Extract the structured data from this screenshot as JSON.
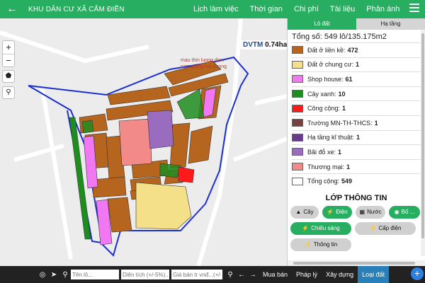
{
  "header": {
    "title": "KHU DÂN CƯ XÃ CẨM ĐIỀN",
    "nav": [
      "Lịch làm việc",
      "Thời gian",
      "Chi phí",
      "Tài liệu",
      "Phản ánh"
    ],
    "back_icon": "arrow-left-icon",
    "menu_icon": "hamburger-icon"
  },
  "map": {
    "zoom_in": "+",
    "zoom_out": "−",
    "dvtm_label": "DVTM",
    "dvtm_value": "0.74ha",
    "label_line1": "mau thin luong dien",
    "label_line2": "cam giang hai duong"
  },
  "panel": {
    "tab_active": "Lô đất",
    "tab_inactive": "Hạ tầng",
    "total": "Tổng số: 549 lô/135.175m2",
    "legend": [
      {
        "label": "Đất ở liền kề:",
        "count": "472",
        "color": "#b5651d"
      },
      {
        "label": "Đất ở chung cư:",
        "count": "1",
        "color": "#f5e08a"
      },
      {
        "label": "Shop house:",
        "count": "61",
        "color": "#f277f2"
      },
      {
        "label": "Cây xanh:",
        "count": "10",
        "color": "#1e8c1e"
      },
      {
        "label": "Công cộng:",
        "count": "1",
        "color": "#ff1a1a"
      },
      {
        "label": "Trường MN-TH-THCS:",
        "count": "1",
        "color": "#7a3f3f"
      },
      {
        "label": "Hạ tầng kĩ thuật:",
        "count": "1",
        "color": "#6a3a8f"
      },
      {
        "label": "Bãi đỗ xe:",
        "count": "1",
        "color": "#9a6cc0"
      },
      {
        "label": "Thương mại:",
        "count": "1",
        "color": "#f28a8a"
      },
      {
        "label": "Tổng cộng:",
        "count": "549",
        "color": "#ffffff"
      }
    ],
    "layer_title": "LỚP THÔNG TIN",
    "buttons": [
      {
        "label": "Cây",
        "state": "off",
        "icon": "tree-icon"
      },
      {
        "label": "Điện",
        "state": "on",
        "icon": "bolt-icon"
      },
      {
        "label": "Nước",
        "state": "off",
        "icon": "water-icon"
      },
      {
        "label": "Bố ...",
        "state": "on",
        "icon": "eye-icon"
      },
      {
        "label": "Chiếu sáng",
        "state": "on",
        "icon": "bolt-icon"
      },
      {
        "label": "Cấp điện",
        "state": "off",
        "icon": "bolt-icon"
      },
      {
        "label": "Thông tin",
        "state": "off",
        "icon": "bolt-icon"
      }
    ]
  },
  "bottom": {
    "input1_placeholder": "Tên lô...",
    "input2_placeholder": "Diện tích (+/-5%)...",
    "input3_placeholder": "Giá bán tr vnđ...(+/-5%)",
    "links": [
      "Mua bán",
      "Pháp lý",
      "Xây dựng",
      "Loại đất"
    ],
    "active_link": "Loại đất",
    "fab": "+"
  }
}
